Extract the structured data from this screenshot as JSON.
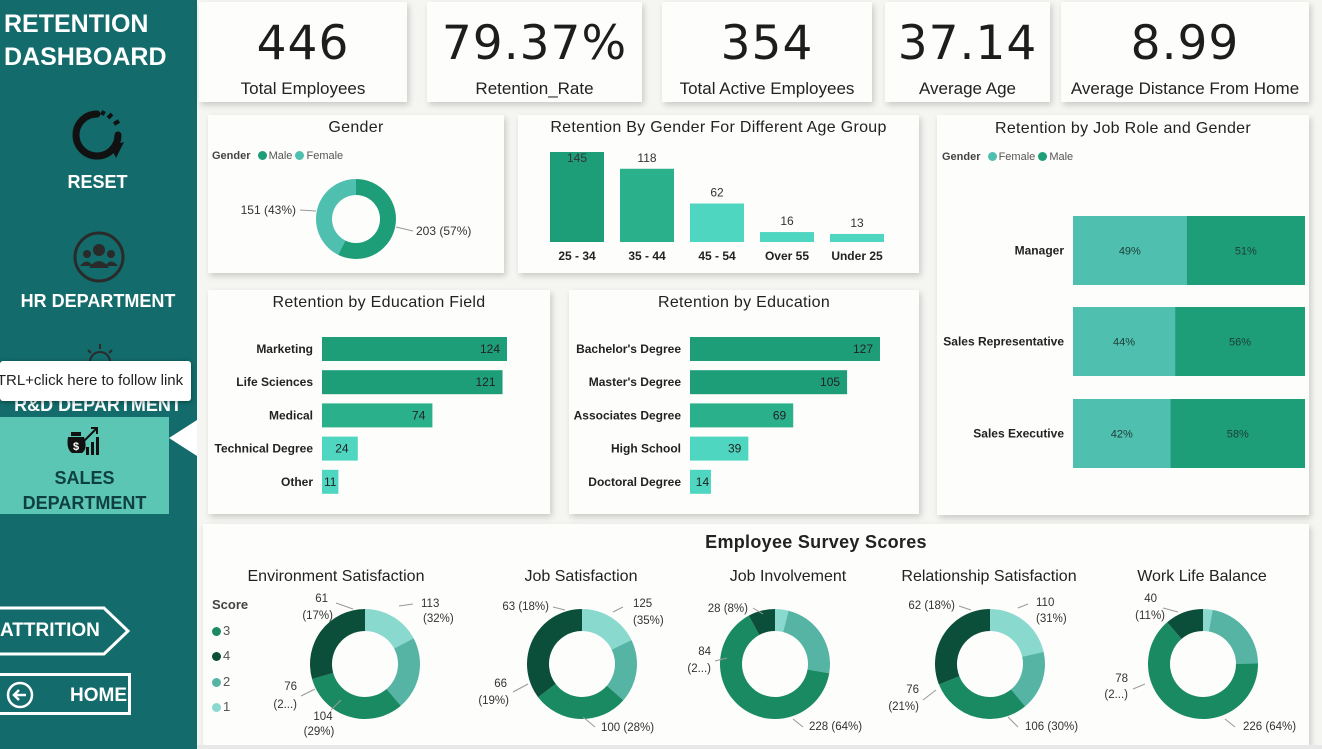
{
  "sidebar": {
    "title_line1": "RETENTION",
    "title_line2": "DASHBOARD",
    "reset_label": "RESET",
    "hr_label": "HR DEPARTMENT",
    "rd_label": "R&D DEPARTMENT",
    "sales_line1": "SALES",
    "sales_line2": "DEPARTMENT",
    "attrition_label": "ATTRITION",
    "home_label": "HOME",
    "tooltip": "CTRL+click here to follow link"
  },
  "kpis": [
    {
      "value": "446",
      "label": "Total Employees"
    },
    {
      "value": "79.37%",
      "label": "Retention_Rate"
    },
    {
      "value": "354",
      "label": "Total Active Employees"
    },
    {
      "value": "37.14",
      "label": "Average Age"
    },
    {
      "value": "8.99",
      "label": "Average Distance From Home"
    }
  ],
  "colors": {
    "male": "#1e9e78",
    "female": "#4fbfaf",
    "score3": "#1a8a63",
    "score4": "#0b4f3a",
    "score2": "#55b4a4",
    "score1": "#8ad9cf",
    "bar_light": "#4fd6c0"
  },
  "gender": {
    "title": "Gender",
    "legend_title": "Gender",
    "legend": [
      "Male",
      "Female"
    ],
    "label_female": "151 (43%)",
    "label_male": "203 (57%)"
  },
  "age_group": {
    "title": "Retention By Gender For Different Age Group"
  },
  "job_role": {
    "title": "Retention by Job Role and Gender",
    "legend_title": "Gender",
    "legend": [
      "Female",
      "Male"
    ]
  },
  "edu_field": {
    "title": "Retention by Education Field"
  },
  "education": {
    "title": "Retention by Education"
  },
  "survey": {
    "title": "Employee Survey Scores",
    "score_legend_title": "Score",
    "score_legend": [
      "3",
      "4",
      "2",
      "1"
    ],
    "donuts": [
      {
        "title": "Environment Satisfaction",
        "values": {
          "3": 113,
          "4": 104,
          "2": 76,
          "1": 61
        },
        "labels": [
          [
            "113",
            "(32%)"
          ],
          [
            "104",
            "(29%)"
          ],
          [
            "76",
            "(2...)"
          ],
          [
            "61",
            "(17%)"
          ]
        ]
      },
      {
        "title": "Job Satisfaction",
        "values": {
          "4": 125,
          "3": 100,
          "2": 66,
          "1": 63
        },
        "labels": [
          [
            "125",
            "(35%)"
          ],
          [
            "100 (28%)"
          ],
          [
            "66",
            "(19%)"
          ],
          [
            "63 (18%)"
          ]
        ]
      },
      {
        "title": "Job Involvement",
        "values": {
          "3": 228,
          "2": 84,
          "4": 28,
          "1": 14
        },
        "labels": [
          [
            "228 (64%)"
          ],
          [
            "84",
            "(2...)"
          ],
          [
            "28 (8%)"
          ]
        ]
      },
      {
        "title": "Relationship Satisfaction",
        "values": {
          "4": 110,
          "3": 106,
          "1": 76,
          "2": 62
        },
        "labels": [
          [
            "110",
            "(31%)"
          ],
          [
            "106 (30%)"
          ],
          [
            "76",
            "(21%)"
          ],
          [
            "62 (18%)"
          ]
        ]
      },
      {
        "title": "Work Life Balance",
        "values": {
          "3": 226,
          "2": 78,
          "4": 40,
          "1": 10
        },
        "labels": [
          [
            "226 (64%)"
          ],
          [
            "78",
            "(2...)"
          ],
          [
            "40",
            "(11%)"
          ]
        ]
      }
    ]
  },
  "chart_data": [
    {
      "type": "pie",
      "title": "Gender",
      "categories": [
        "Male",
        "Female"
      ],
      "values": [
        203,
        151
      ],
      "percents": [
        57,
        43
      ]
    },
    {
      "type": "bar",
      "title": "Retention By Gender For Different Age Group",
      "categories": [
        "25 - 34",
        "35 - 44",
        "45 - 54",
        "Over 55",
        "Under 25"
      ],
      "values": [
        145,
        118,
        62,
        16,
        13
      ]
    },
    {
      "type": "bar",
      "title": "Retention by Job Role and Gender",
      "categories": [
        "Manager",
        "Sales Representative",
        "Sales Executive"
      ],
      "series": [
        {
          "name": "Female",
          "values": [
            49,
            44,
            42
          ]
        },
        {
          "name": "Male",
          "values": [
            51,
            56,
            58
          ]
        }
      ],
      "value_labels": [
        [
          "49%",
          "51%"
        ],
        [
          "44%",
          "56%"
        ],
        [
          "42%",
          "58%"
        ]
      ]
    },
    {
      "type": "bar",
      "title": "Retention by Education Field",
      "categories": [
        "Marketing",
        "Life Sciences",
        "Medical",
        "Technical Degree",
        "Other"
      ],
      "values": [
        124,
        121,
        74,
        24,
        11
      ]
    },
    {
      "type": "bar",
      "title": "Retention by Education",
      "categories": [
        "Bachelor's Degree",
        "Master's Degree",
        "Associates Degree",
        "High School",
        "Doctoral Degree"
      ],
      "values": [
        127,
        105,
        69,
        39,
        14
      ]
    }
  ]
}
